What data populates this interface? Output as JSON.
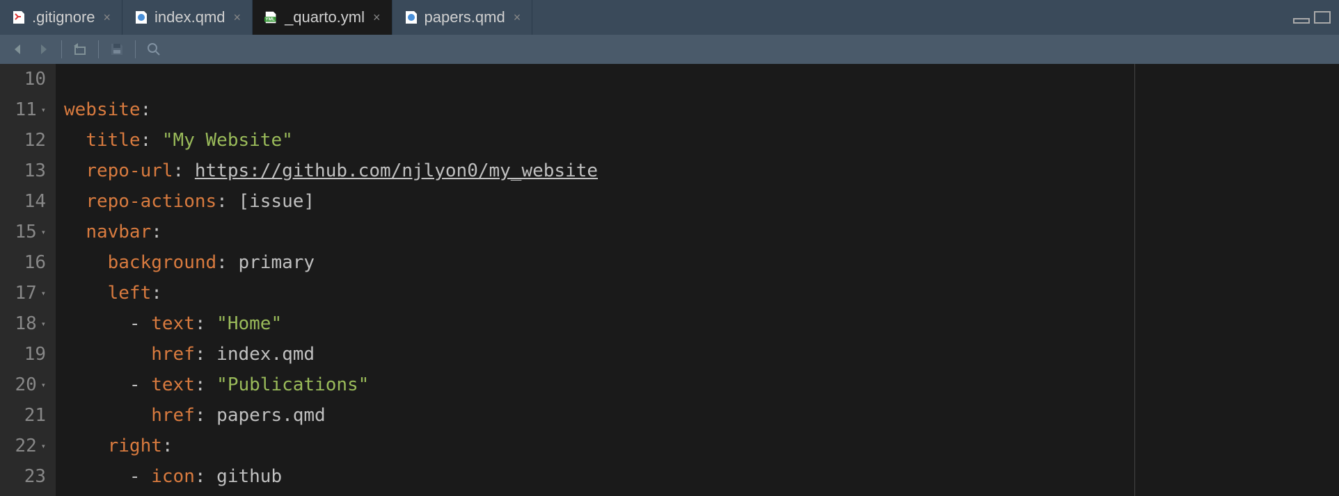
{
  "tabs": [
    {
      "label": ".gitignore",
      "type": "git"
    },
    {
      "label": "index.qmd",
      "type": "qmd"
    },
    {
      "label": "_quarto.yml",
      "type": "yml",
      "active": true
    },
    {
      "label": "papers.qmd",
      "type": "qmd"
    }
  ],
  "gutter": {
    "start": 10,
    "lines": [
      {
        "num": "10"
      },
      {
        "num": "11",
        "fold": true
      },
      {
        "num": "12"
      },
      {
        "num": "13"
      },
      {
        "num": "14"
      },
      {
        "num": "15",
        "fold": true
      },
      {
        "num": "16"
      },
      {
        "num": "17",
        "fold": true
      },
      {
        "num": "18",
        "fold": true
      },
      {
        "num": "19"
      },
      {
        "num": "20",
        "fold": true
      },
      {
        "num": "21"
      },
      {
        "num": "22",
        "fold": true
      },
      {
        "num": "23"
      }
    ]
  },
  "code": {
    "l10": "",
    "k_website": "website",
    "k_title": "title",
    "v_title": "\"My Website\"",
    "k_repourl": "repo-url",
    "v_repourl": "https://github.com/njlyon0/my_website",
    "k_repoactions": "repo-actions",
    "v_repoactions_open": "[",
    "v_repoactions_item": "issue",
    "v_repoactions_close": "]",
    "k_navbar": "navbar",
    "k_background": "background",
    "v_background": "primary",
    "k_left": "left",
    "k_text": "text",
    "v_text_home": "\"Home\"",
    "k_href": "href",
    "v_href_index": "index.qmd",
    "v_text_pubs": "\"Publications\"",
    "v_href_papers": "papers.qmd",
    "k_right": "right",
    "k_icon": "icon",
    "v_icon": "github",
    "colon": ":",
    "dash": "-"
  }
}
